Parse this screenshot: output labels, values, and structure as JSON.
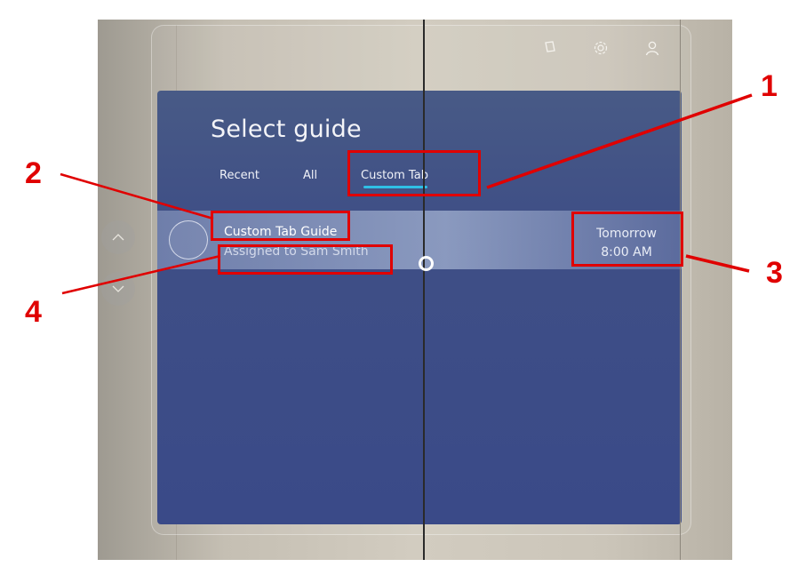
{
  "panel": {
    "title": "Select guide"
  },
  "tabs": [
    {
      "label": "Recent",
      "selected": false
    },
    {
      "label": "All",
      "selected": false
    },
    {
      "label": "Custom Tab",
      "selected": true
    }
  ],
  "guide_row": {
    "name": "Custom Tab Guide",
    "assigned": "Assigned to Sam Smith",
    "when_day": "Tomorrow",
    "when_time": "8:00 AM"
  },
  "toolbar": {
    "icons": [
      "window-icon",
      "gear-icon",
      "user-icon"
    ]
  },
  "nav": {
    "up_icon": "chevron-up-icon",
    "down_icon": "chevron-down-icon"
  },
  "callouts": {
    "c1": "1",
    "c2": "2",
    "c3": "3",
    "c4": "4"
  },
  "colors": {
    "panel": "#3f4f86",
    "accent_underline": "#2fc0e6",
    "callout": "#e00000"
  }
}
